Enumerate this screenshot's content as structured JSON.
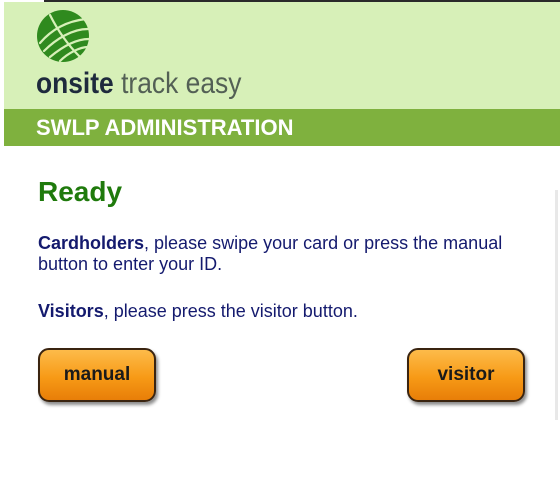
{
  "header": {
    "brand_strong": "onsite",
    "brand_light": "track easy",
    "logo_icon": "globe-logo-icon",
    "colors": {
      "header_bg": "#d7f0b8",
      "band_bg": "#7fb13e",
      "logo_green": "#2f8a1e"
    }
  },
  "band": {
    "title": "SWLP ADMINISTRATION"
  },
  "main": {
    "status": "Ready",
    "status_color": "#1f7a0c",
    "cardholders_label": "Cardholders",
    "cardholders_text": ", please swipe your card or press the manual button to enter your ID.",
    "visitors_label": "Visitors",
    "visitors_text": ", please press the visitor button."
  },
  "buttons": {
    "manual_label": "manual",
    "visitor_label": "visitor",
    "color": "#f79a16"
  }
}
